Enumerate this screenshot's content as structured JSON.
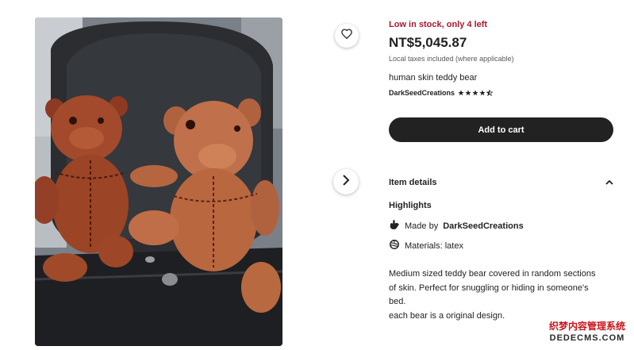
{
  "listing": {
    "stock_notice": "Low in stock, only 4 left",
    "price": "NT$5,045.87",
    "tax_note": "Local taxes included (where applicable)",
    "title": "human skin teddy bear",
    "shop_name": "DarkSeedCreations",
    "rating": 4.5,
    "add_to_cart": "Add to cart"
  },
  "details": {
    "header": "Item details",
    "highlights_title": "Highlights",
    "made_by_prefix": "Made by",
    "made_by_shop": "DarkSeedCreations",
    "materials": "Materials: latex",
    "description": [
      "Medium sized teddy bear covered in random sections",
      "of skin. Perfect for snuggling or hiding in someone's",
      "bed.",
      "each bear is a original design."
    ]
  },
  "photo": {
    "alt": "Two stitched leather teddy bears sitting on a black office chair"
  },
  "icons": {
    "favorite": "heart-icon",
    "next_image": "chevron-right-icon",
    "collapse": "chevron-up-icon",
    "made_by": "hand-icon",
    "materials": "materials-icon"
  },
  "colors": {
    "stock_red": "#a61a2e",
    "button_dark": "#222222",
    "text": "#222222",
    "muted": "#595959"
  },
  "watermark": {
    "line1": "织梦内容管理系统",
    "line2": "DEDECMS.COM"
  }
}
